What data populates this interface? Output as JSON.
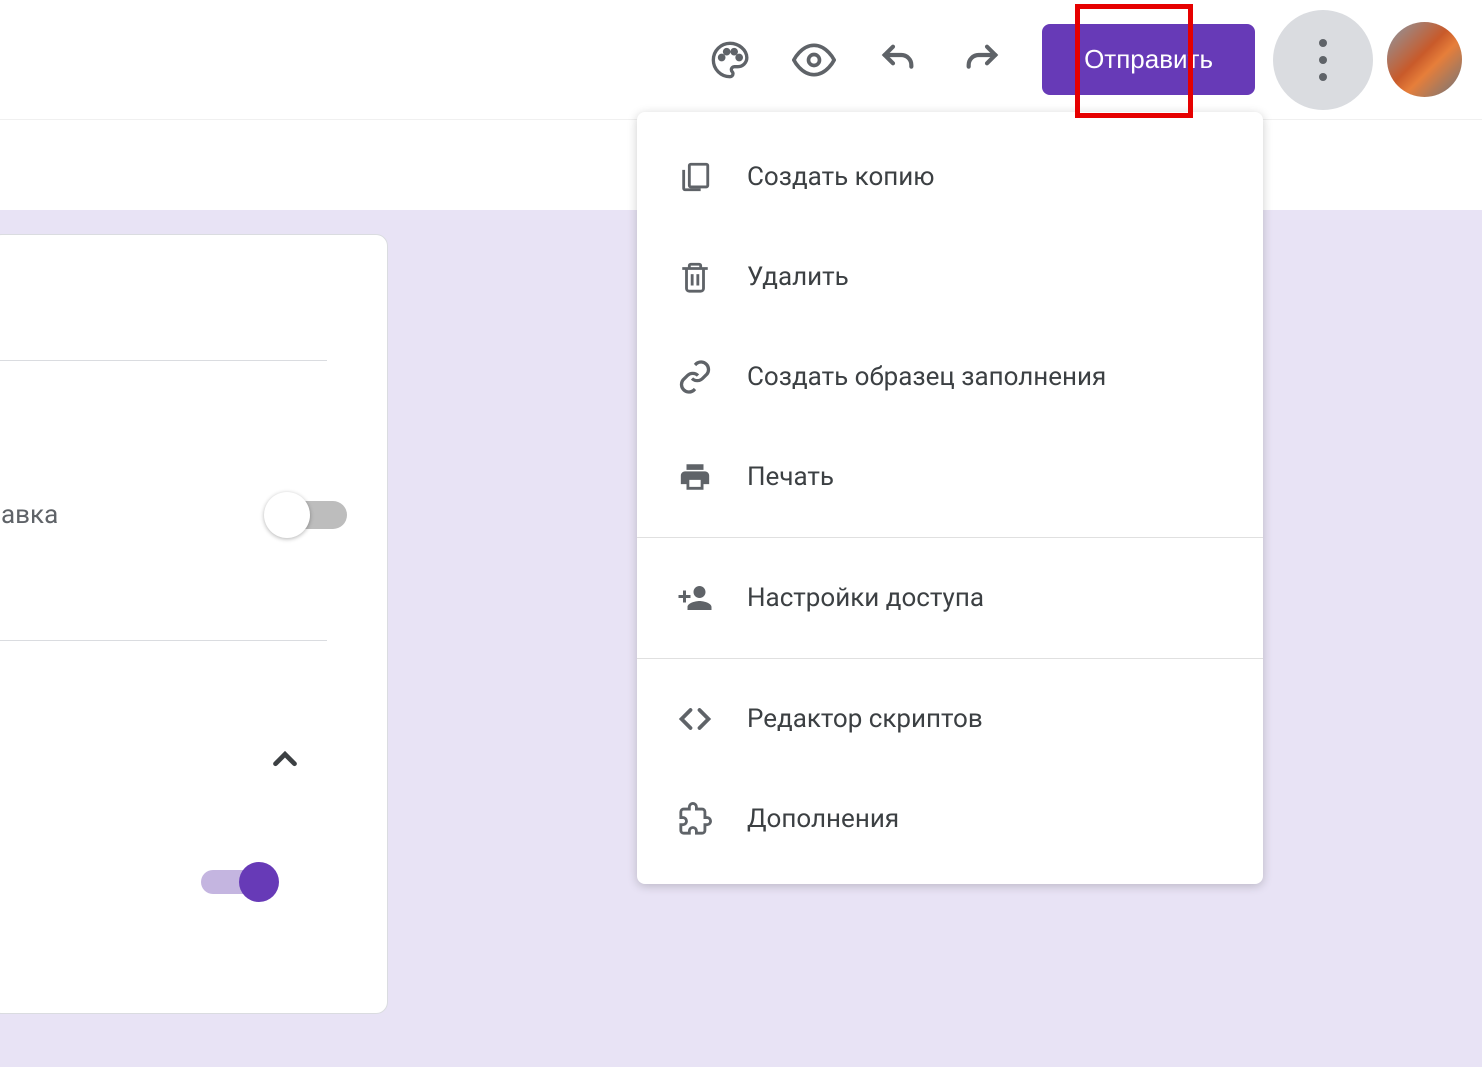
{
  "toolbar": {
    "send_label": "Отправить"
  },
  "card": {
    "row_label": "авка"
  },
  "menu": {
    "items": [
      {
        "icon": "copy",
        "label": "Создать копию"
      },
      {
        "icon": "delete",
        "label": "Удалить"
      },
      {
        "icon": "link",
        "label": "Создать образец заполнения"
      },
      {
        "icon": "print",
        "label": "Печать"
      }
    ],
    "items2": [
      {
        "icon": "share",
        "label": "Настройки доступа"
      }
    ],
    "items3": [
      {
        "icon": "code",
        "label": "Редактор скриптов"
      },
      {
        "icon": "extension",
        "label": "Дополнения"
      }
    ]
  }
}
